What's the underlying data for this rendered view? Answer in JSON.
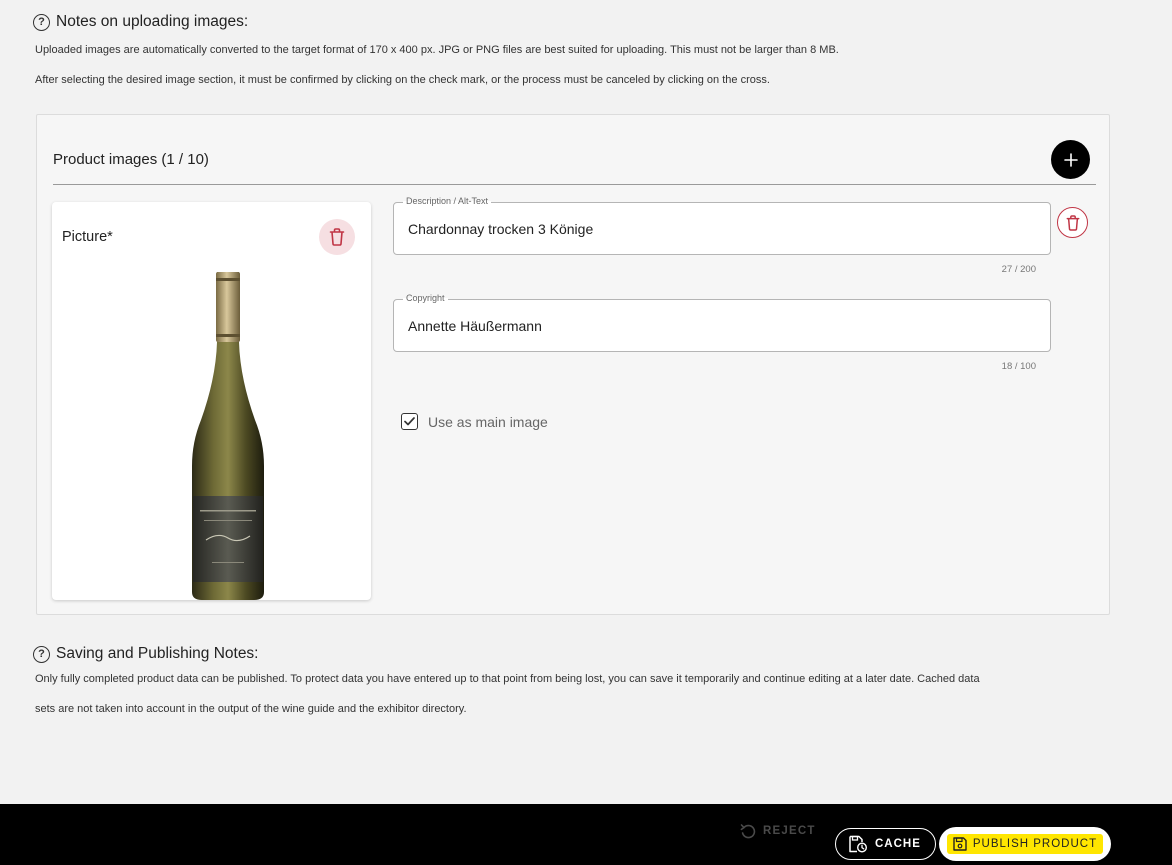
{
  "upload_notes": {
    "title": "Notes on uploading images:",
    "line1": "Uploaded images are automatically converted to the target format of 170 x 400 px. JPG or PNG files are best suited for uploading. This must not be larger than 8 MB.",
    "line2": "After selecting the desired image section, it must be confirmed by clicking on the check mark, or the process must be canceled by clicking on the cross."
  },
  "product_images": {
    "title": "Product images (1 / 10)",
    "add_icon": "plus-icon",
    "picture": {
      "label": "Picture*",
      "delete_icon": "trash-icon",
      "image_icon": "wine-bottle"
    },
    "description": {
      "label": "Description / Alt-Text",
      "value": "Chardonnay trocken 3 Könige",
      "counter": "27 / 200"
    },
    "copyright": {
      "label": "Copyright",
      "value": "Annette Häußermann",
      "counter": "18 / 100"
    },
    "main_image": {
      "label": "Use as main image",
      "checked": true
    }
  },
  "saving_notes": {
    "title": "Saving and Publishing Notes:",
    "line1": "Only fully completed product data can be published. To protect data you have entered up to that point from being lost, you can save it temporarily and continue editing at a later date. Cached data",
    "line2": "sets are not taken into account in the output of the wine guide and the exhibitor directory."
  },
  "footer": {
    "reject_label": "REJECT",
    "cache_label": "CACHE",
    "publish_label": "PUBLISH PRODUCT"
  },
  "colors": {
    "danger": "#c03545",
    "highlight": "#ffe600",
    "footer_bg": "#000000",
    "page_bg": "#f2f2f2"
  }
}
